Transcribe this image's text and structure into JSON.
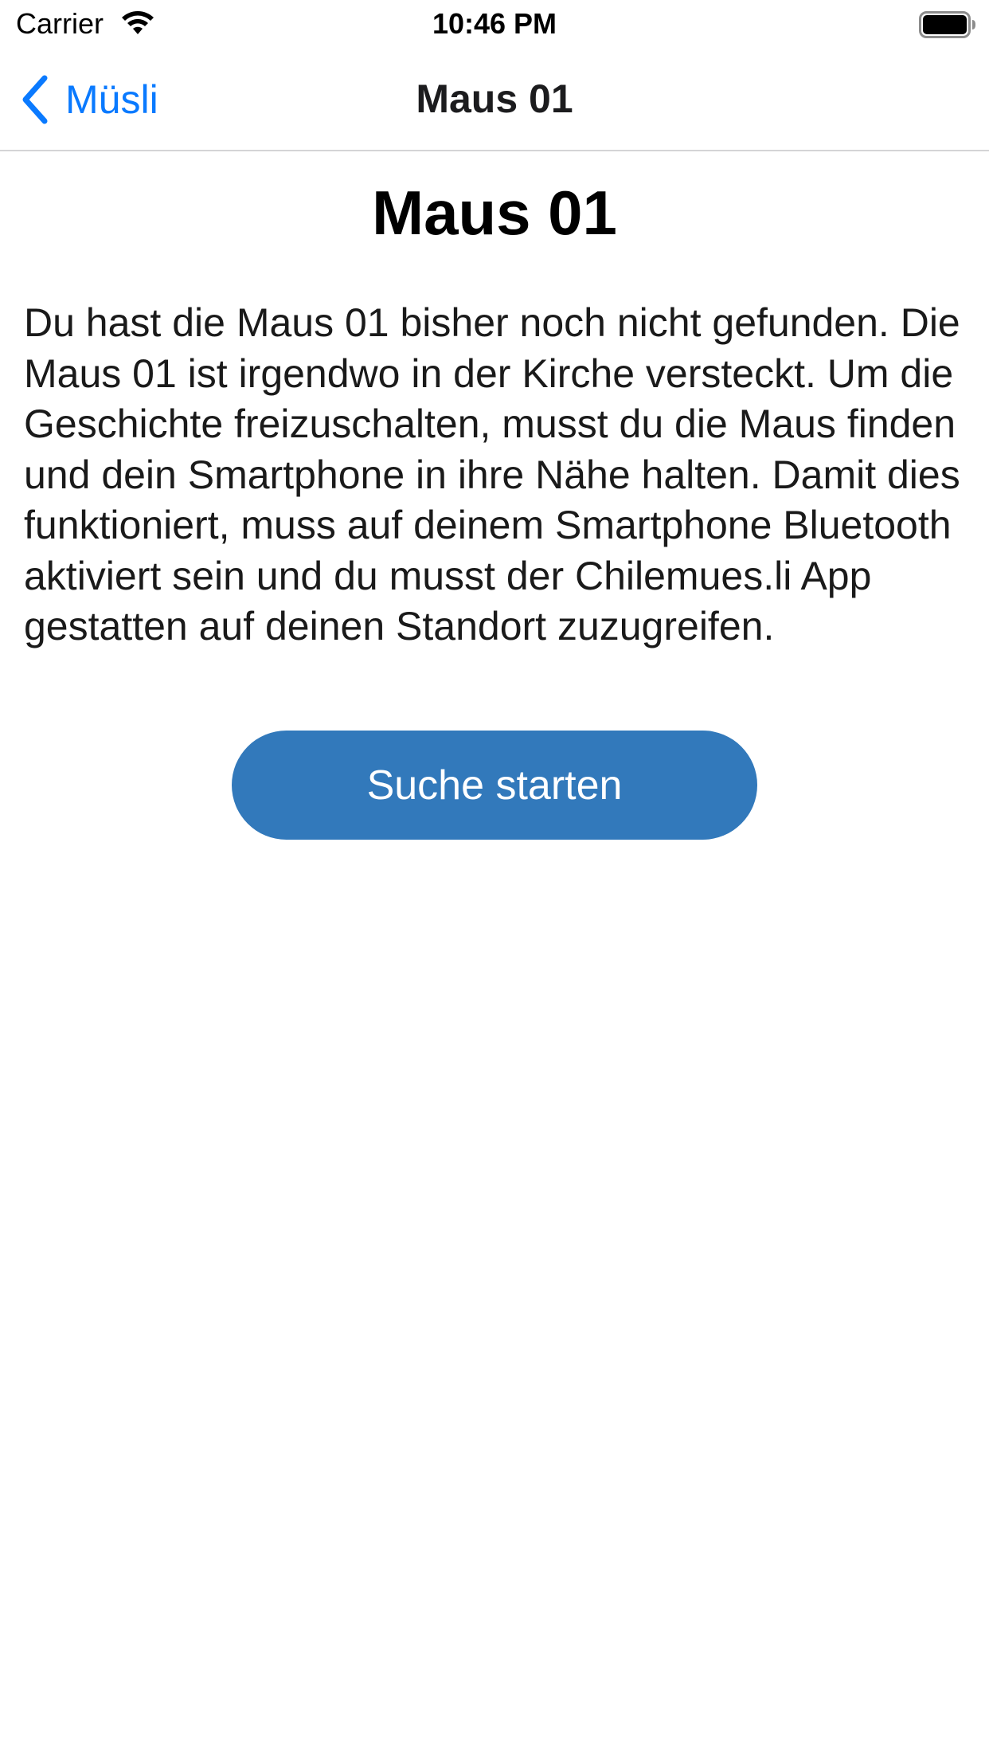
{
  "status_bar": {
    "carrier": "Carrier",
    "time": "10:46 PM",
    "wifi_icon": "wifi-icon",
    "battery_icon": "battery-icon"
  },
  "nav": {
    "back_label": "Müsli",
    "back_icon": "chevron-left-icon",
    "title": "Maus 01"
  },
  "content": {
    "title": "Maus 01",
    "description": "Du hast die Maus 01 bisher noch nicht gefunden. Die Maus 01 ist irgendwo in der Kirche versteckt. Um die Geschichte freizuschalten, musst du die Maus finden und dein Smartphone in ihre Nähe halten. Damit dies funktioniert, muss auf deinem Smartphone Bluetooth aktiviert sein und du musst der Chilemues.li App gestatten auf deinen Standort zuzugreifen.",
    "button_label": "Suche starten"
  },
  "colors": {
    "accent": "#0a7aff",
    "button_bg": "#3279bb",
    "button_text": "#ffffff",
    "divider": "#d4d4d6"
  }
}
